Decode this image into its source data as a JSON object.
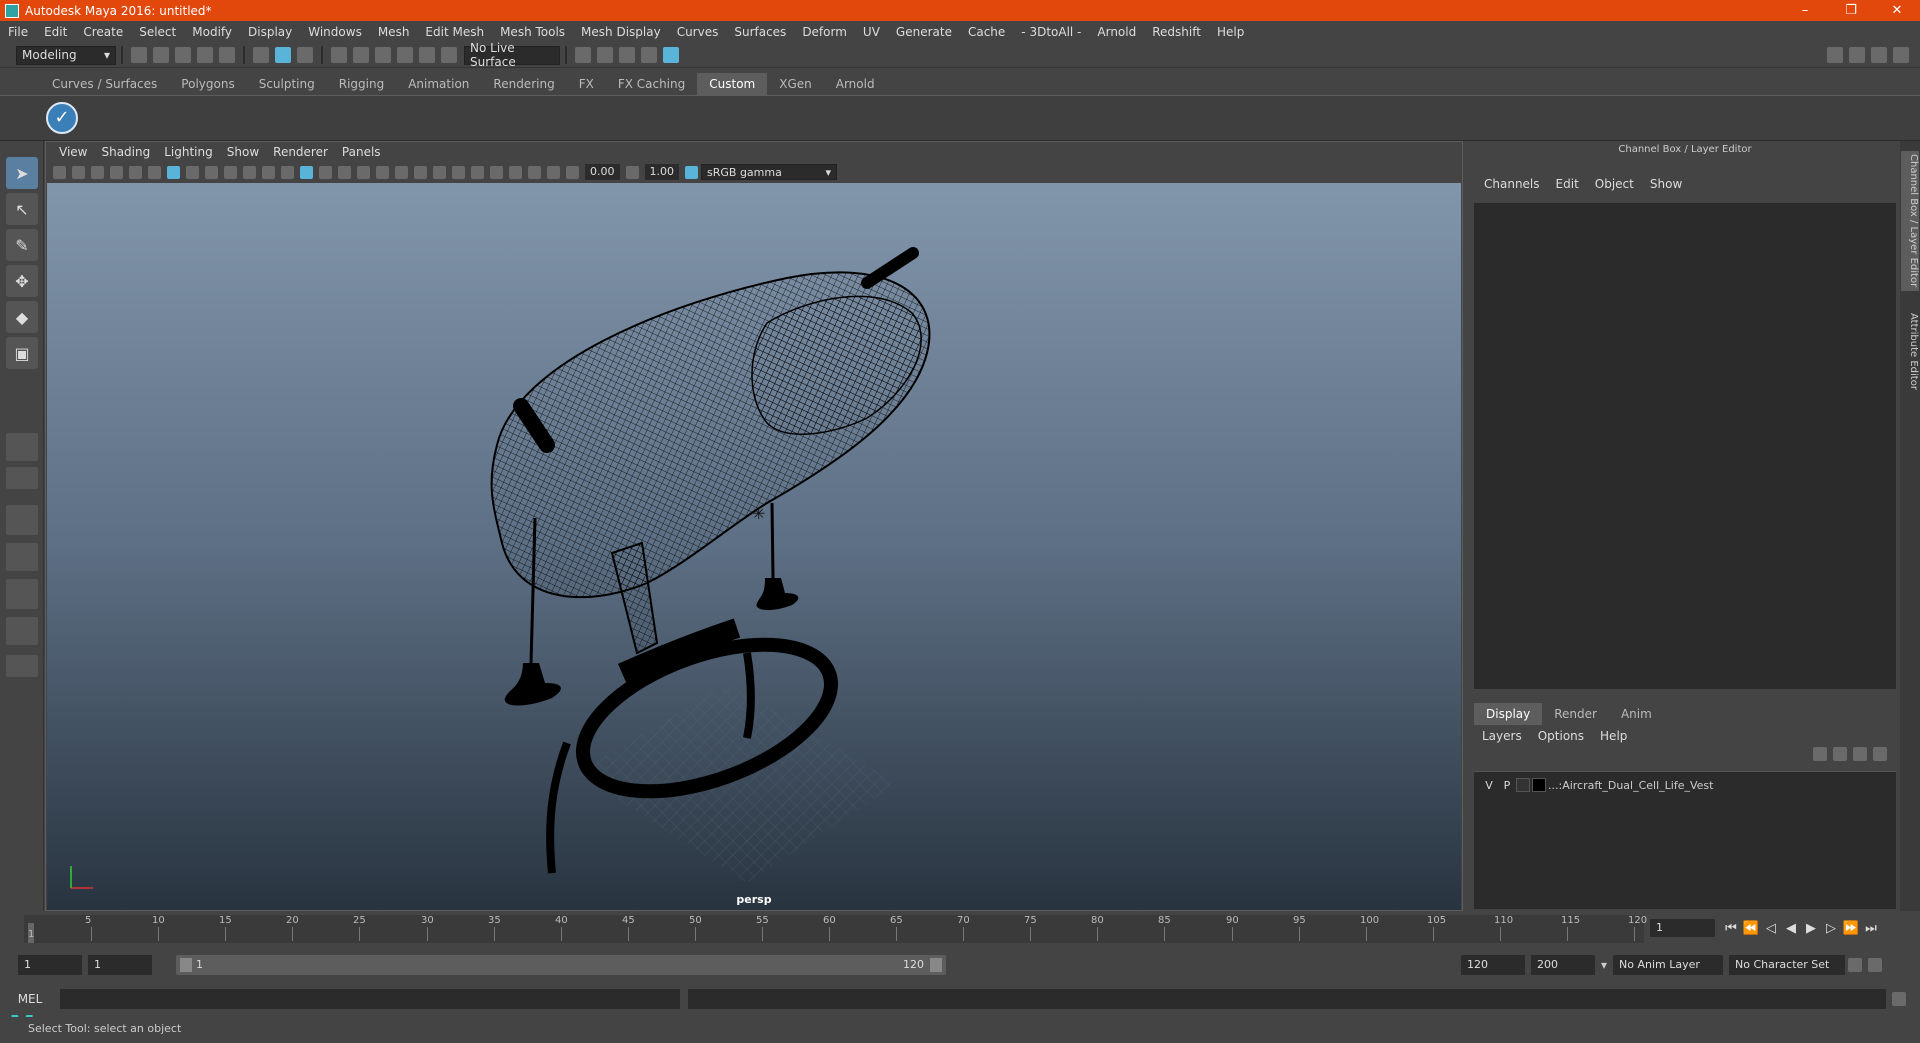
{
  "window": {
    "title": "Autodesk Maya 2016: untitled*",
    "controls": [
      "–",
      "❐",
      "✕"
    ]
  },
  "menus": [
    "File",
    "Edit",
    "Create",
    "Select",
    "Modify",
    "Display",
    "Windows",
    "Mesh",
    "Edit Mesh",
    "Mesh Tools",
    "Mesh Display",
    "Curves",
    "Surfaces",
    "Deform",
    "UV",
    "Generate",
    "Cache",
    "- 3DtoAll -",
    "Arnold",
    "Redshift",
    "Help"
  ],
  "statusline": {
    "mode": "Modeling",
    "live_surface": "No Live Surface"
  },
  "shelf_tabs": [
    "Curves / Surfaces",
    "Polygons",
    "Sculpting",
    "Rigging",
    "Animation",
    "Rendering",
    "FX",
    "FX Caching",
    "Custom",
    "XGen",
    "Arnold"
  ],
  "shelf_active": "Custom",
  "viewport": {
    "menu": [
      "View",
      "Shading",
      "Lighting",
      "Show",
      "Renderer",
      "Panels"
    ],
    "exposure": "0.00",
    "gamma": "1.00",
    "color_space": "sRGB gamma",
    "camera": "persp"
  },
  "channel_box": {
    "title": "Channel Box / Layer Editor",
    "menu": [
      "Channels",
      "Edit",
      "Object",
      "Show"
    ],
    "layer_tabs": [
      "Display",
      "Render",
      "Anim"
    ],
    "layer_tab_active": "Display",
    "layer_menu": [
      "Layers",
      "Options",
      "Help"
    ],
    "layer": {
      "v": "V",
      "p": "P",
      "name": "...:Aircraft_Dual_Cell_Life_Vest"
    }
  },
  "side_tabs": [
    "Channel Box / Layer Editor",
    "Attribute Editor"
  ],
  "timeline": {
    "ticks": [
      "5",
      "10",
      "15",
      "20",
      "25",
      "30",
      "35",
      "40",
      "45",
      "50",
      "55",
      "60",
      "65",
      "70",
      "75",
      "80",
      "85",
      "90",
      "95",
      "100",
      "105",
      "110",
      "115",
      "120"
    ],
    "start_label": "1",
    "current_frame": "1"
  },
  "range": {
    "start": "1",
    "playback_start": "1",
    "slider_start": "1",
    "slider_end": "120",
    "playback_end": "120",
    "end": "200",
    "anim_layer": "No Anim Layer",
    "character_set": "No Character Set"
  },
  "command_line": {
    "label": "MEL"
  },
  "help_line": "Select Tool: select an object"
}
